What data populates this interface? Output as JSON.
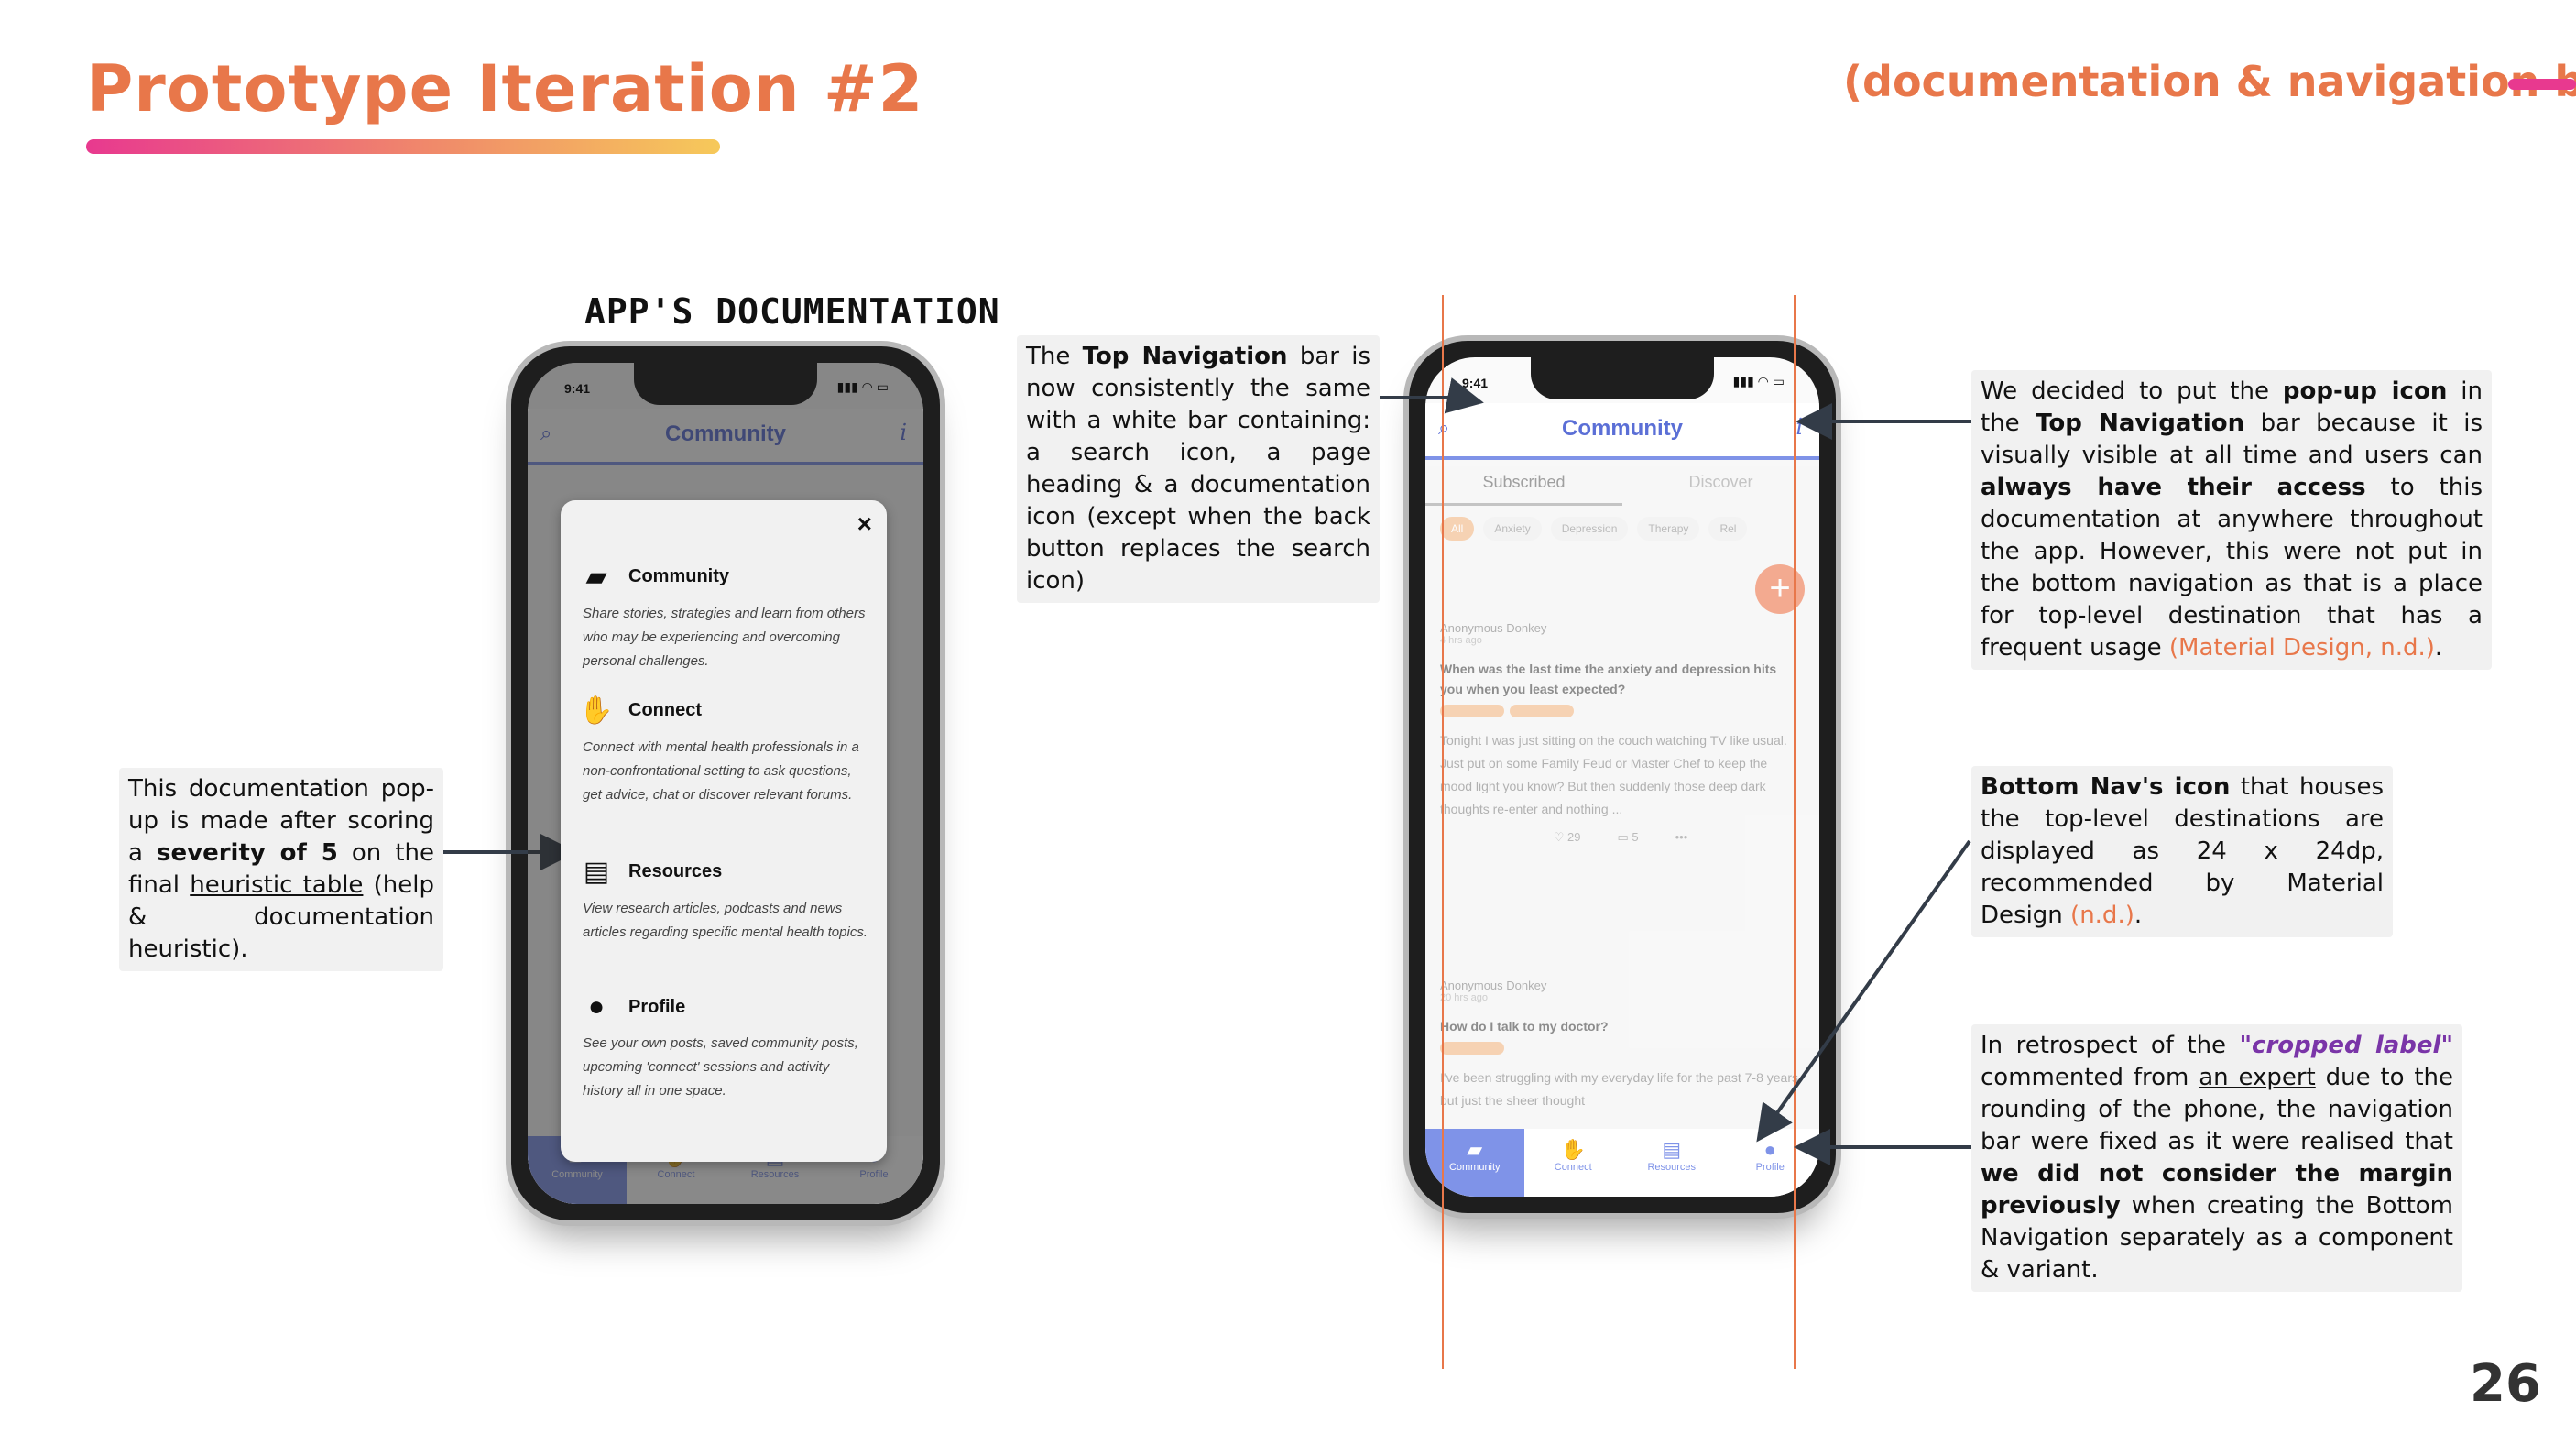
{
  "header": {
    "title": "Prototype Iteration #2",
    "subtitle": "(documentation & navigation bars)",
    "page_number": "26"
  },
  "left_phone_caption": "APP'S DOCUMENTATION",
  "phone_common": {
    "time": "9:41",
    "status_icons": "▮▮▮ ◠ ▭",
    "nav_title": "Community",
    "search_icon": "⌕",
    "info_icon": "i",
    "bottom_nav": [
      {
        "label": "Community",
        "icon": "chat-icon",
        "glyph": "▰"
      },
      {
        "label": "Connect",
        "icon": "handshake-icon",
        "glyph": "✋"
      },
      {
        "label": "Resources",
        "icon": "document-icon",
        "glyph": "▤"
      },
      {
        "label": "Profile",
        "icon": "person-icon",
        "glyph": "●"
      }
    ]
  },
  "modal": {
    "close": "×",
    "sections": [
      {
        "title": "Community",
        "icon": "chat-icon",
        "glyph": "▰",
        "desc": "Share stories, strategies and learn from others who may be experiencing and overcoming personal challenges."
      },
      {
        "title": "Connect",
        "icon": "handshake-icon",
        "glyph": "✋",
        "desc": "Connect with mental health professionals in a non-confrontational setting to ask questions, get advice, chat or discover relevant forums."
      },
      {
        "title": "Resources",
        "icon": "document-icon",
        "glyph": "▤",
        "desc": "View research articles, podcasts and news articles regarding specific mental health topics."
      },
      {
        "title": "Profile",
        "icon": "person-icon",
        "glyph": "●",
        "desc": "See your own posts, saved community posts, upcoming 'connect' sessions and activity history all in one space."
      }
    ]
  },
  "feed": {
    "tabs": [
      "Subscribed",
      "Discover"
    ],
    "chips": [
      "All",
      "Anxiety",
      "Depression",
      "Therapy",
      "Rel"
    ],
    "fab": "+",
    "posts": [
      {
        "author": "Anonymous Donkey",
        "ago": "4 hrs ago",
        "question": "When was the last time the anxiety and depression hits you when you least expected?",
        "body": "Tonight I was just sitting on the couch watching TV like usual. Just put on some Family Feud or Master Chef to keep the mood light you know? But then suddenly those deep dark thoughts re-enter and nothing ...",
        "likes": "29",
        "comments": "5",
        "more": "•••"
      },
      {
        "author": "Anonymous Donkey",
        "ago": "20 hrs ago",
        "question": "How do I talk to my doctor?",
        "body": "I've been struggling with my everyday life for the past 7-8 years but just the sheer thought"
      }
    ]
  },
  "notes": {
    "left": {
      "p1": "This documentation pop-up is made after scoring a ",
      "b1": "severity of 5",
      "p2": " on the final ",
      "u1": "heuristic table",
      "p3": " (help & documentation heuristic)."
    },
    "top_nav": {
      "p1": "The ",
      "b1": "Top Navigation",
      "p2": " bar is now consistently the same with a white bar containing: a search icon, a page heading & a documentation icon (except when the back button replaces the search icon)"
    },
    "popup_icon": {
      "p1": "We decided to put the ",
      "b1": "pop-up icon",
      "p2": " in the ",
      "b2": "Top Navigation",
      "p3": " bar because it is visually visible at all time and users can ",
      "b3": "always have their access",
      "p4": " to this documentation at anywhere throughout the app. However, this were not put in the bottom navigation as that is a place for top-level destination that has a frequent usage ",
      "ref": "(Material Design, n.d.)",
      "p5": "."
    },
    "bottom_icon": {
      "b1": "Bottom Nav's icon",
      "p1": " that houses the top-level destinations are displayed as 24 x 24dp, recommended by Material Design ",
      "ref": "(n.d.)",
      "p2": "."
    },
    "retrospect": {
      "p1": "In retrospect of the ",
      "em": "\"cropped label\"",
      "p2": " commented from ",
      "u1": "an expert",
      "p3": " due to the rounding of the phone, the navigation bar were fixed as it were realised that ",
      "b1": "we did not consider the margin previously",
      "p4": " when creating the Bottom Navigation separately as a component & variant."
    }
  },
  "colors": {
    "accent_orange": "#e8774a",
    "accent_pink": "#e8398f",
    "nav_blue": "#7f93e8",
    "note_bg": "#f1f1f1"
  }
}
